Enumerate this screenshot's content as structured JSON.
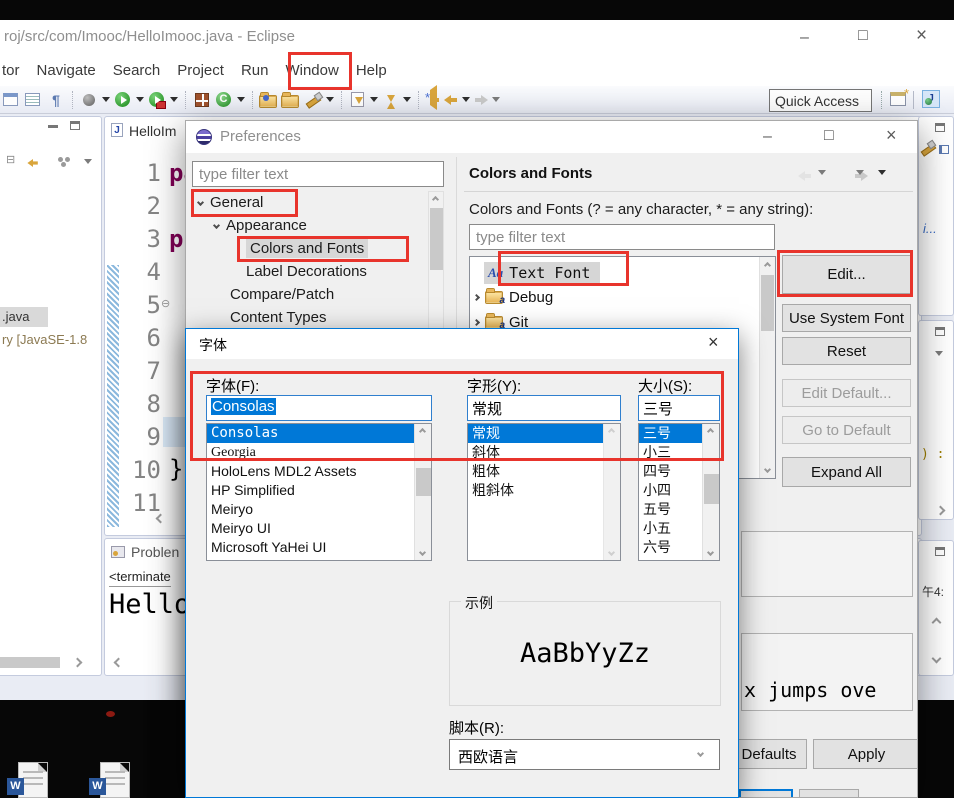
{
  "icons": {
    "minimize": "–",
    "maximize": "□",
    "close": "×",
    "fold": "⊖",
    "java_file": "J",
    "word": "W",
    "pilcrow": "¶",
    "aa": "Aa"
  },
  "eclipse": {
    "title": "roj/src/com/Imooc/HelloImooc.java - Eclipse",
    "menus": [
      "tor",
      "Navigate",
      "Search",
      "Project",
      "Run",
      "Window",
      "Help"
    ],
    "quick_access": "Quick Access",
    "package_explorer": {
      "item_java": ".java",
      "item_jre": "ry [JavaSE-1.8"
    },
    "editor": {
      "tab": "HelloIm",
      "line_numbers": [
        "1",
        "2",
        "3",
        "4",
        "5",
        "6",
        "7",
        "8",
        "9",
        "10",
        "11"
      ],
      "code_line1": "pa",
      "code_line3": "pu",
      "code_line10": "}"
    },
    "problems_tab": "Problen",
    "console": {
      "status": "<terminate",
      "output": "Hello"
    },
    "side": {
      "tasklist_text": "i...",
      "outline_text": ") : vc",
      "time_text": "午4:"
    }
  },
  "preferences": {
    "title": "Preferences",
    "filter_placeholder": "type filter text",
    "tree": {
      "general": "General",
      "appearance": "Appearance",
      "colors_and_fonts": "Colors and Fonts",
      "label_decorations": "Label Decorations",
      "compare_patch": "Compare/Patch",
      "content_types": "Content Types"
    },
    "header": "Colors and Fonts",
    "filter_label": "Colors and Fonts (? = any character, * = any string):",
    "filter_placeholder2": "type filter text",
    "font_tree": {
      "text_font": "Text Font",
      "debug": "Debug",
      "git": "Git"
    },
    "buttons": {
      "edit": "Edit...",
      "use_system_font": "Use System Font",
      "reset": "Reset",
      "edit_default": "Edit Default...",
      "go_to_default": "Go to Default",
      "expand_all": "Expand All",
      "defaults": "Defaults",
      "apply": "Apply"
    },
    "preview_text": "x jumps ove"
  },
  "font_dialog": {
    "title": "字体",
    "font_label": "字体(F):",
    "style_label": "字形(Y):",
    "size_label": "大小(S):",
    "font_value": "Consolas",
    "style_value": "常规",
    "size_value": "三号",
    "fonts": [
      "Consolas",
      "Georgia",
      "HoloLens MDL2 Assets",
      "HP Simplified",
      "Meiryo",
      "Meiryo UI",
      "Microsoft YaHei UI"
    ],
    "styles": [
      "常规",
      "斜体",
      "粗体",
      "粗斜体"
    ],
    "sizes": [
      "三号",
      "小三",
      "四号",
      "小四",
      "五号",
      "小五",
      "六号"
    ],
    "sample_label": "示例",
    "sample_text": "AaBbYyZz",
    "script_label": "脚本(R):",
    "script_value": "西欧语言"
  }
}
